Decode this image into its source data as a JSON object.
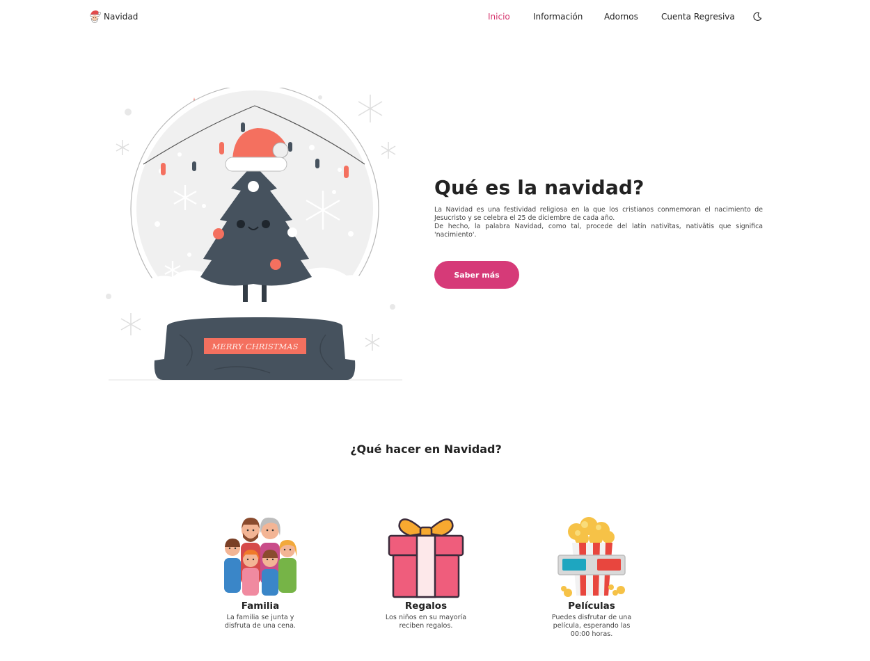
{
  "nav": {
    "brand": "Navidad",
    "links": [
      {
        "label": "Inicio",
        "active": true
      },
      {
        "label": "Información",
        "active": false
      },
      {
        "label": "Adornos",
        "active": false
      },
      {
        "label": "Cuenta Regresiva",
        "active": false
      }
    ],
    "theme_icon": "moon-icon"
  },
  "hero": {
    "illustration_banner": "MERRY CHRISTMAS",
    "title": "Qué es la navidad?",
    "desc_1": "La Navidad es una festividad religiosa en la que los cristianos conmemoran el nacimiento de Jesucristo y se celebra el 25 de diciembre de cada año.",
    "desc_2": "De hecho, la palabra Navidad, como tal, procede del latín nativĭtas, nativātis que significa 'nacimiento'.",
    "button": "Saber más"
  },
  "section": {
    "title": "¿Qué hacer en Navidad?",
    "cards": [
      {
        "title": "Familia",
        "desc": "La familia se junta y disfruta de una cena.",
        "icon": "family-icon"
      },
      {
        "title": "Regalos",
        "desc": "Los niños en su mayoría reciben regalos.",
        "icon": "gift-icon"
      },
      {
        "title": "Películas",
        "desc": "Puedes disfrutar de una película, esperando las 00:00 horas.",
        "icon": "popcorn-icon"
      }
    ]
  },
  "colors": {
    "accent": "#d6336c",
    "button": "#d63a78",
    "tree": "#46525e",
    "coral": "#f4705f"
  }
}
